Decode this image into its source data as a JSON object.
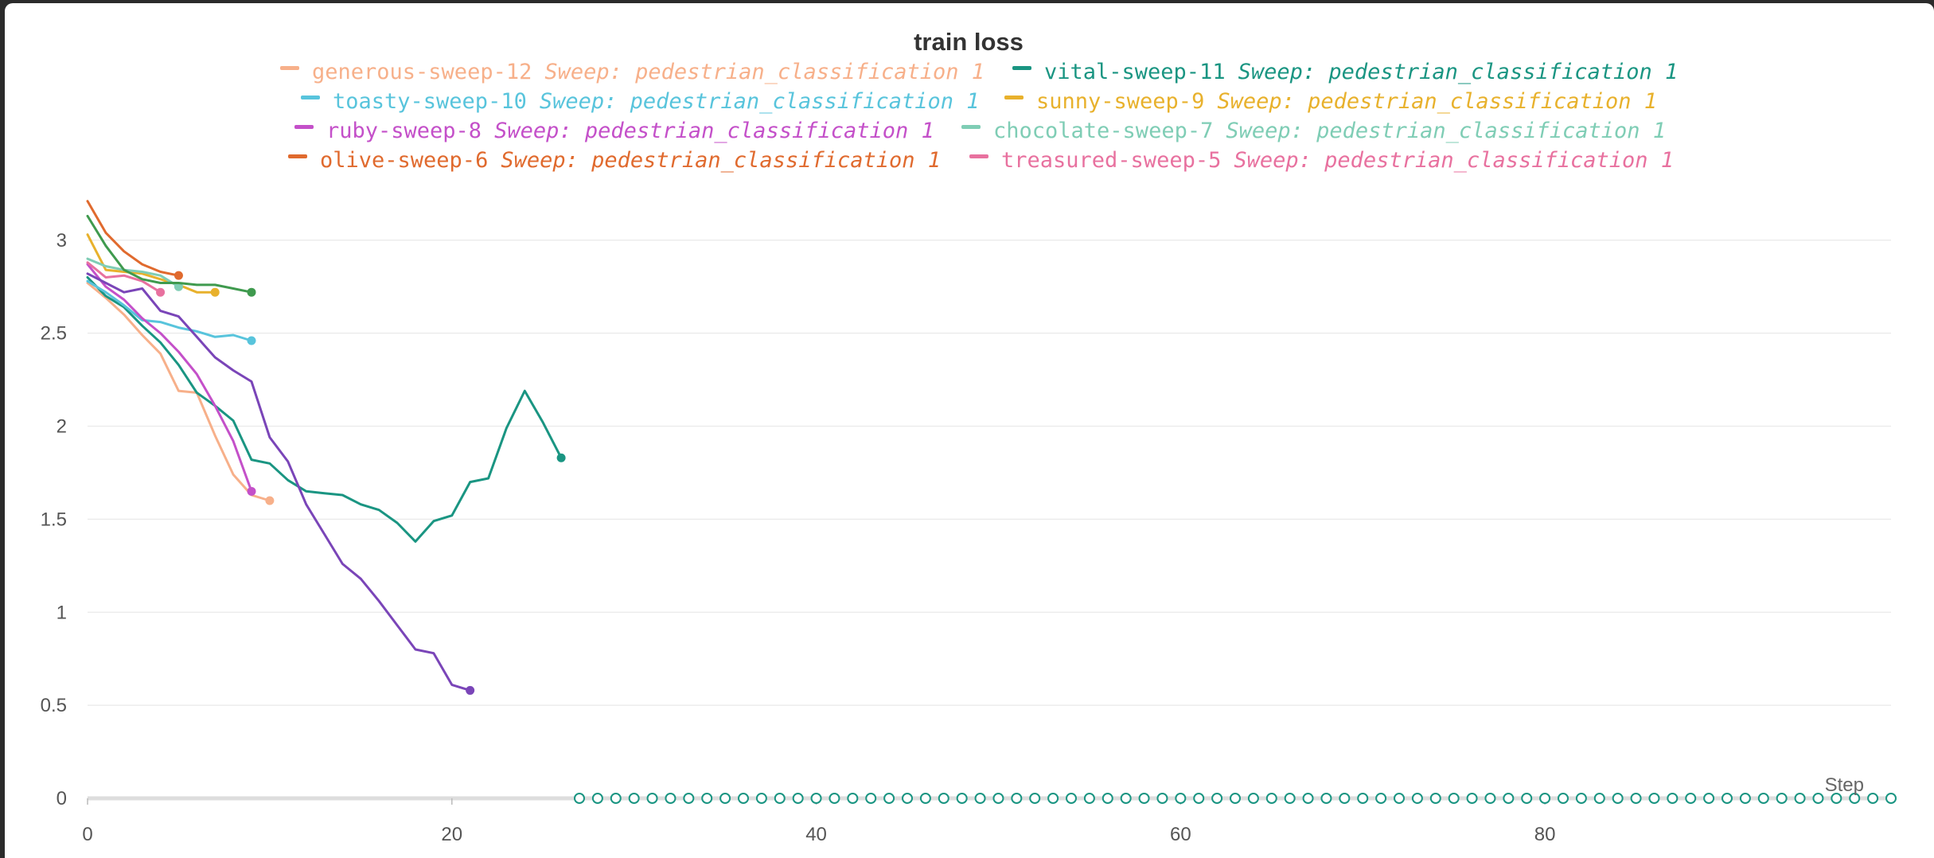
{
  "chart_data": {
    "type": "line",
    "title": "train loss",
    "xlabel": "Step",
    "ylabel": "",
    "xlim": [
      0,
      99
    ],
    "ylim": [
      0,
      3.2
    ],
    "grid": true,
    "legend_position": "top",
    "x_ticks": [
      "0",
      "20",
      "40",
      "60",
      "80"
    ],
    "x_tick_values": [
      0,
      20,
      40,
      60,
      80
    ],
    "y_ticks": [
      "0",
      "0.5",
      "1",
      "1.5",
      "2",
      "2.5",
      "3"
    ],
    "y_tick_values": [
      0,
      0.5,
      1,
      1.5,
      2,
      2.5,
      3
    ],
    "series": [
      {
        "name": "generous-sweep-12",
        "run": "Sweep: pedestrian_classification 1",
        "color": "#f7b08a",
        "x": [
          0,
          1,
          2,
          3,
          4,
          5,
          6,
          7,
          8,
          9,
          10
        ],
        "y": [
          2.77,
          2.69,
          2.6,
          2.49,
          2.39,
          2.19,
          2.18,
          1.95,
          1.74,
          1.63,
          1.6
        ]
      },
      {
        "name": "vital-sweep-11",
        "run": "Sweep: pedestrian_classification 1",
        "color": "#1a9582",
        "x": [
          0,
          1,
          2,
          3,
          4,
          5,
          6,
          7,
          8,
          9,
          10,
          11,
          12,
          13,
          14,
          15,
          16,
          17,
          18,
          19,
          20,
          21,
          22,
          23,
          24,
          25,
          26
        ],
        "y": [
          2.8,
          2.7,
          2.64,
          2.54,
          2.45,
          2.33,
          2.18,
          2.11,
          2.03,
          1.82,
          1.8,
          1.71,
          1.65,
          1.64,
          1.63,
          1.58,
          1.55,
          1.48,
          1.38,
          1.49,
          1.52,
          1.7,
          1.72,
          1.99,
          2.19,
          2.02,
          1.83
        ]
      },
      {
        "name": "toasty-sweep-10",
        "run": "Sweep: pedestrian_classification 1",
        "color": "#58c4dc",
        "x": [
          0,
          1,
          2,
          3,
          4,
          5,
          6,
          7,
          8,
          9
        ],
        "y": [
          2.78,
          2.72,
          2.65,
          2.57,
          2.56,
          2.53,
          2.51,
          2.48,
          2.49,
          2.46
        ]
      },
      {
        "name": "sunny-sweep-9",
        "run": "Sweep: pedestrian_classification 1",
        "color": "#e8b12c",
        "x": [
          0,
          1,
          2,
          3,
          4,
          5,
          6,
          7
        ],
        "y": [
          3.03,
          2.84,
          2.83,
          2.82,
          2.79,
          2.76,
          2.72,
          2.72
        ]
      },
      {
        "name": "ruby-sweep-8",
        "run": "Sweep: pedestrian_classification 1",
        "color": "#c450c9",
        "x": [
          0,
          1,
          2,
          3,
          4,
          5,
          6,
          7,
          8,
          9
        ],
        "y": [
          2.87,
          2.75,
          2.68,
          2.58,
          2.5,
          2.4,
          2.28,
          2.11,
          1.92,
          1.65
        ]
      },
      {
        "name": "chocolate-sweep-7",
        "run": "Sweep: pedestrian_classification 1",
        "color": "#7fcdb5",
        "x": [
          0,
          1,
          2,
          3,
          4,
          5
        ],
        "y": [
          2.9,
          2.86,
          2.84,
          2.83,
          2.81,
          2.75
        ]
      },
      {
        "name": "olive-sweep-6",
        "run": "Sweep: pedestrian_classification 1",
        "color": "#e06a2e",
        "x": [
          0,
          1,
          2,
          3,
          4,
          5
        ],
        "y": [
          3.21,
          3.04,
          2.94,
          2.87,
          2.83,
          2.81
        ]
      },
      {
        "name": "treasured-sweep-5",
        "run": "Sweep: pedestrian_classification 1",
        "color": "#e8719f",
        "x": [
          0,
          1,
          2,
          3,
          4
        ],
        "y": [
          2.88,
          2.8,
          2.81,
          2.78,
          2.72
        ]
      },
      {
        "name": "",
        "run": "",
        "color": "#7a45b8",
        "x": [
          0,
          1,
          2,
          3,
          4,
          5,
          6,
          7,
          8,
          9,
          10,
          11,
          12,
          13,
          14,
          15,
          16,
          17,
          18,
          19,
          20,
          21
        ],
        "y": [
          2.82,
          2.77,
          2.72,
          2.74,
          2.62,
          2.59,
          2.48,
          2.37,
          2.3,
          2.24,
          1.94,
          1.81,
          1.58,
          1.42,
          1.26,
          1.18,
          1.06,
          0.93,
          0.8,
          0.78,
          0.61,
          0.58
        ]
      },
      {
        "name": "",
        "run": "",
        "color": "#3f9a4e",
        "x": [
          0,
          1,
          2,
          3,
          4,
          5,
          6,
          7,
          8,
          9
        ],
        "y": [
          3.13,
          2.97,
          2.84,
          2.79,
          2.77,
          2.77,
          2.76,
          2.76,
          2.74,
          2.72
        ]
      }
    ],
    "zero_marker_series": {
      "color": "#1a9582",
      "x_start": 27,
      "x_end": 99,
      "x_step": 1,
      "y": 0
    }
  }
}
